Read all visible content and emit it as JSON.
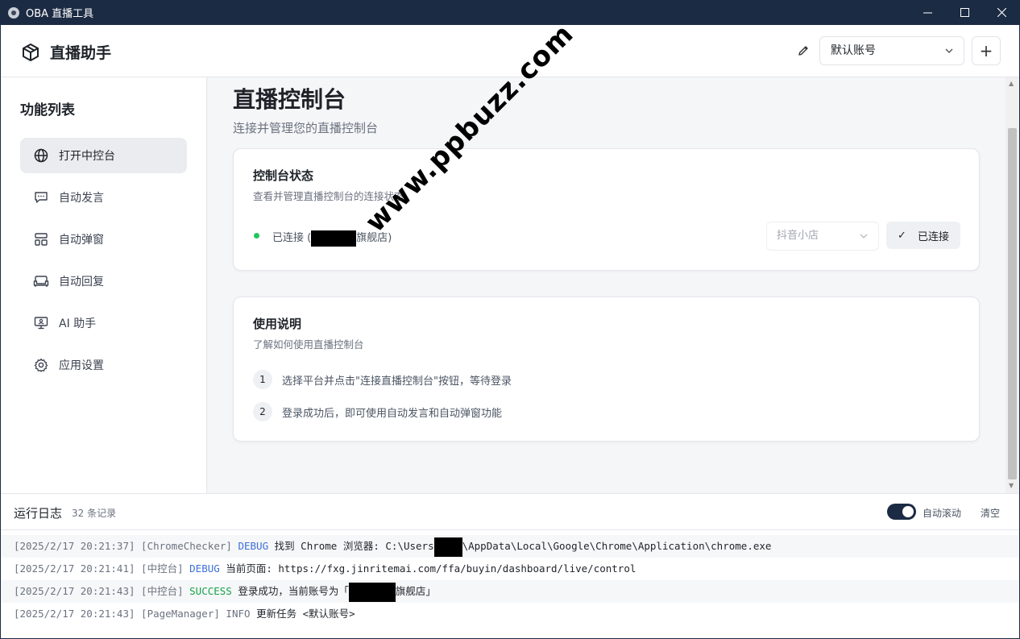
{
  "window": {
    "title": "OBA 直播工具",
    "minimize": "—",
    "maximize": "☐",
    "close": "✕"
  },
  "header": {
    "brand": "直播助手",
    "account_select": "默认账号",
    "add_label": "+"
  },
  "sidebar": {
    "title": "功能列表",
    "items": [
      {
        "label": "打开中控台",
        "icon": "globe-icon",
        "active": true
      },
      {
        "label": "自动发言",
        "icon": "message-icon"
      },
      {
        "label": "自动弹窗",
        "icon": "layout-icon"
      },
      {
        "label": "自动回复",
        "icon": "sofa-icon"
      },
      {
        "label": "AI 助手",
        "icon": "monitor-icon"
      },
      {
        "label": "应用设置",
        "icon": "gear-icon"
      }
    ]
  },
  "main": {
    "title": "直播控制台",
    "subtitle": "连接并管理您的直播控制台",
    "status_card": {
      "title": "控制台状态",
      "description": "查看并管理直播控制台的连接状态",
      "status_prefix": "已连接 (",
      "status_suffix": "旗舰店)",
      "platform": "抖音小店",
      "connected_label": "已连接",
      "status_color": "#22c55e"
    },
    "help_card": {
      "title": "使用说明",
      "description": "了解如何使用直播控制台",
      "steps": [
        {
          "num": "1",
          "text": "选择平台并点击\"连接直播控制台\"按钮，等待登录"
        },
        {
          "num": "2",
          "text": "登录成功后，即可使用自动发言和自动弹窗功能"
        }
      ]
    }
  },
  "log": {
    "title": "运行日志",
    "count": "32 条记录",
    "autoscroll": "自动滚动",
    "autoscroll_on": true,
    "clear": "清空",
    "entries": [
      {
        "ts": "[2025/2/17 20:21:37]",
        "src": "[ChromeChecker]",
        "level": "DEBUG",
        "msg_a": "找到 Chrome 浏览器: C:\\Users",
        "msg_b": "\\AppData\\Local\\Google\\Chrome\\Application\\chrome.exe"
      },
      {
        "ts": "[2025/2/17 20:21:41]",
        "src": "[中控台]",
        "level": "DEBUG",
        "msg_a": "当前页面: https://fxg.jinritemai.com/ffa/buyin/dashboard/live/control",
        "msg_b": ""
      },
      {
        "ts": "[2025/2/17 20:21:43]",
        "src": "[中控台]",
        "level": "SUCCESS",
        "msg_a": "登录成功，当前账号为「",
        "msg_b": "旗舰店」"
      },
      {
        "ts": "[2025/2/17 20:21:43]",
        "src": "[PageManager]",
        "level": "INFO",
        "msg_a": "更新任务 <默认账号>",
        "msg_b": ""
      }
    ]
  },
  "watermark": "www.ppbuzz.com",
  "colors": {
    "titlebar": "#1c2b44",
    "accent": "#1c2b44",
    "success": "#16a34a",
    "debug": "#3b6fd8"
  }
}
